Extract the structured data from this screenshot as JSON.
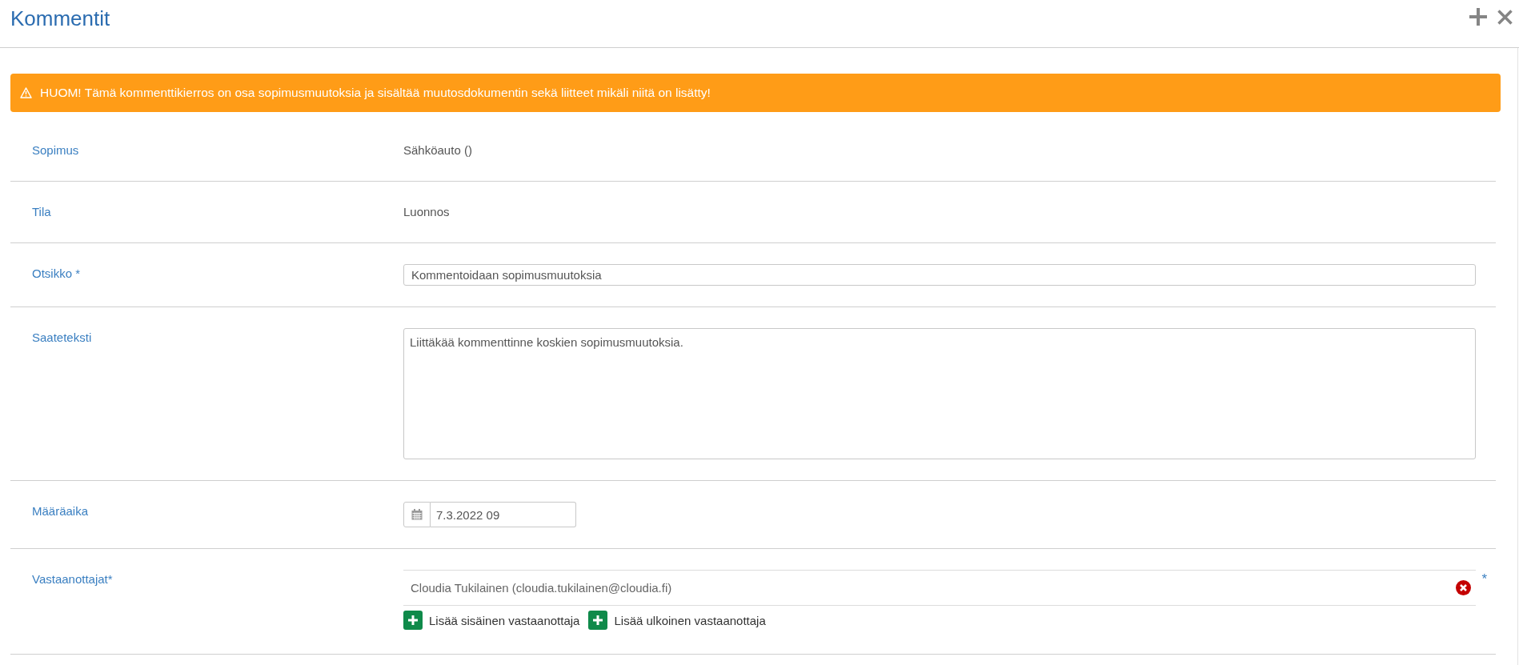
{
  "window": {
    "title": "Kommentit"
  },
  "warning": {
    "text": "HUOM! Tämä kommenttikierros on osa sopimusmuutoksia ja sisältää muutosdokumentin sekä liitteet mikäli niitä on lisätty!"
  },
  "fields": [
    {
      "kind": "text",
      "label": "Sopimus",
      "value": "Sähköauto ()"
    },
    {
      "kind": "text",
      "label": "Tila",
      "value": "Luonnos"
    },
    {
      "kind": "input",
      "label": "Otsikko *",
      "value": "Kommentoidaan sopimusmuutoksia"
    },
    {
      "kind": "textarea",
      "label": "Saateteksti",
      "value": "Liittäkää kommenttinne koskien sopimusmuutoksia."
    },
    {
      "kind": "date",
      "label": "Määräaika",
      "value": "7.3.2022 09"
    },
    {
      "kind": "recipients",
      "label": "Vastaanottajat*",
      "recipients": [
        "Cloudia Tukilainen (cloudia.tukilainen@cloudia.fi)"
      ],
      "required_mark": "*",
      "actions": [
        "Lisää sisäinen vastaanottaja",
        "Lisää ulkoinen vastaanottaja"
      ]
    }
  ]
}
